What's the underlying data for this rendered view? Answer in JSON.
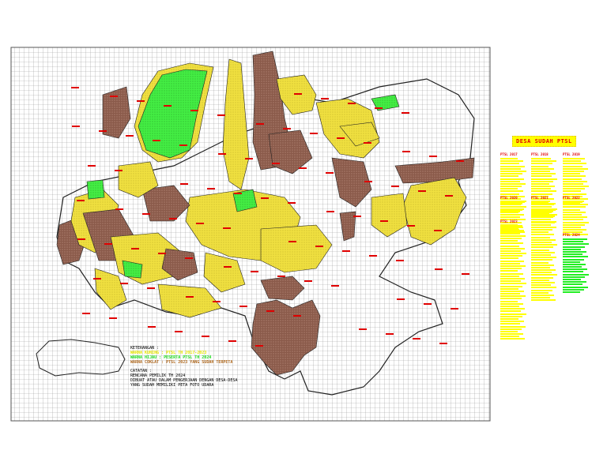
{
  "map": {
    "colors": {
      "yellow": "#f0e040",
      "green": "#44ee44",
      "brown": "#8a5a4a",
      "grid": "#9a9a9a",
      "label": "#e00000"
    }
  },
  "sidebar": {
    "title": "DESA SUDAH PTSL",
    "columns": [
      {
        "header": "PTSL 2017",
        "lines": 22,
        "color": "yellow"
      },
      {
        "header": "PTSL 2018",
        "lines": 26,
        "color": "yellow"
      },
      {
        "header": "PTSL 2019",
        "lines": 20,
        "color": "yellow"
      },
      {
        "header": "PTSL 2020",
        "lines": 13,
        "color": "yellow"
      },
      {
        "header": "PTSL 2021",
        "lines": 40,
        "color": "yellow"
      },
      {
        "header": "PTSL 2022",
        "lines": 14,
        "color": "yellow"
      },
      {
        "header": "PTSL 2023",
        "lines": 46,
        "color": "yellow"
      },
      {
        "header": "PTSL 2024",
        "lines": 22,
        "color": "green"
      }
    ]
  },
  "legend": {
    "title": "KETERANGAN :",
    "yellow": "WARNA KUNING : PTSL TH 2017-2023",
    "green": "WARNA HIJAU : PESERTA PTSL TH 2024",
    "brown": "WARNA COKLAT : PTSL 2023 YANG SUDAH TERPETA",
    "note_title": "CATATAN :",
    "notes": [
      "RENCANA PEMILIK TH 2024",
      "DIBUAT ATAU DALAM PENGERJAAN DENGAN DESA-DESA",
      "YANG SUDAH MEMILIKI PETA FOTO UDARA"
    ]
  }
}
